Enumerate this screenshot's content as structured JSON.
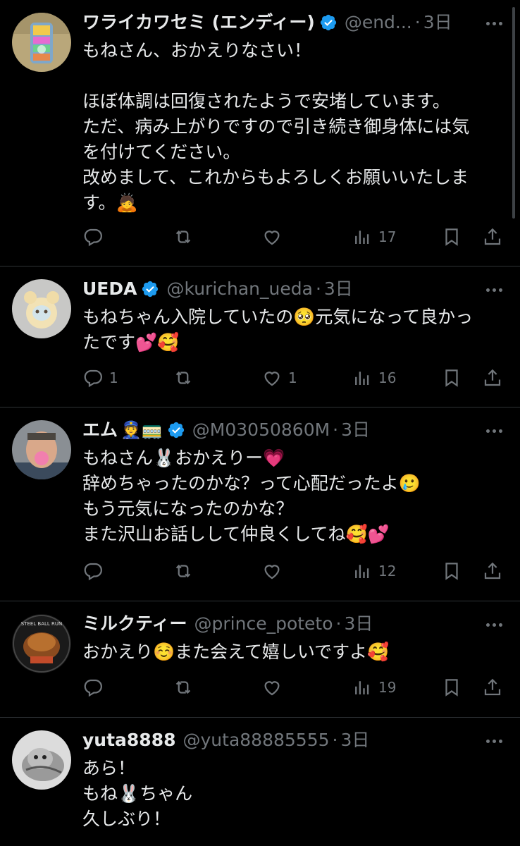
{
  "tweets": [
    {
      "name": "ワライカワセミ (エンディー)",
      "verified": true,
      "handle": "@end...",
      "time": "3日",
      "lines": [
        "もねさん、おかえりなさい！",
        "",
        "ほぼ体調は回復されたようで安堵しています。",
        "ただ、病み上がりですので引き続き御身体には気",
        "を付けてください。",
        "改めまして、これからもよろしくお願いいたしま",
        "す。🙇"
      ],
      "replies": "",
      "retweets": "",
      "likes": "",
      "views": "17"
    },
    {
      "name": "UEDA",
      "verified": true,
      "handle": "@kurichan_ueda",
      "time": "3日",
      "lines": [
        "もねちゃん入院していたの🥺元気になって良かっ",
        "たです💕🥰"
      ],
      "replies": "1",
      "retweets": "",
      "likes": "1",
      "views": "16"
    },
    {
      "name": "エム",
      "name_emoji": "👮🚃",
      "verified": true,
      "handle": "@M03050860M",
      "time": "3日",
      "lines": [
        "もねさん🐰おかえりー💗",
        "辞めちゃったのかな？って心配だったよ🥲",
        "もう元気になったのかな？",
        "また沢山お話しして仲良くしてね🥰💕"
      ],
      "replies": "",
      "retweets": "",
      "likes": "",
      "views": "12"
    },
    {
      "name": "ミルクティー",
      "verified": false,
      "handle": "@prince_poteto",
      "time": "3日",
      "lines": [
        "おかえり☺️また会えて嬉しいですよ🥰"
      ],
      "replies": "",
      "retweets": "",
      "likes": "",
      "views": "19"
    },
    {
      "name": "yuta8888",
      "verified": false,
      "handle": "@yuta88885555",
      "time": "3日",
      "lines": [
        "あら！",
        "もね🐰ちゃん",
        "久しぶり！"
      ],
      "replies": "",
      "retweets": "",
      "likes": "",
      "views": ""
    }
  ],
  "avatar_text": {
    "milktea": "STEEL BALL RUN"
  },
  "icons": {
    "reply": "speech-bubble-icon",
    "retweet": "retweet-arrows-icon",
    "like": "heart-icon",
    "views": "bar-chart-icon",
    "bookmark": "bookmark-icon",
    "share": "share-upload-icon",
    "verified": "verified-badge-icon",
    "more": "more-dots-icon"
  },
  "colors": {
    "background": "#000000",
    "text": "#e7e9ea",
    "secondary": "#71767b",
    "verified": "#1d9bf0",
    "divider": "#2f3336"
  }
}
